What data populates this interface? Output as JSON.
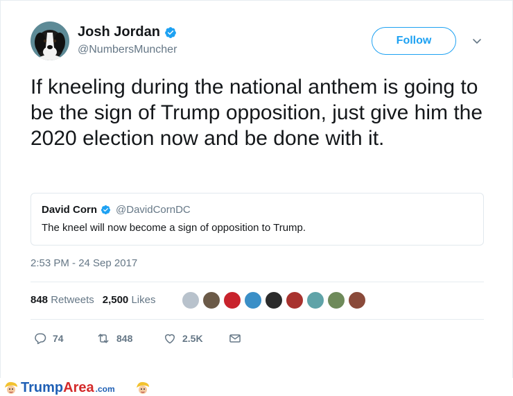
{
  "author": {
    "name": "Josh Jordan",
    "handle": "@NumbersMuncher",
    "verified": true,
    "avatar_icon": "dog-avatar-icon"
  },
  "follow_label": "Follow",
  "tweet_text": "If kneeling during the national anthem is going to be the sign of Trump opposition, just give him the 2020 election now and be done with it.",
  "quoted_tweet": {
    "name": "David Corn",
    "handle": "@DavidCornDC",
    "verified": true,
    "text": "The kneel will now become a sign of opposition to Trump."
  },
  "timestamp": "2:53 PM - 24 Sep 2017",
  "stats": {
    "retweets_count": "848",
    "retweets_label": "Retweets",
    "likes_count": "2,500",
    "likes_label": "Likes"
  },
  "likers": [
    {
      "color": "#b8c2cc"
    },
    {
      "color": "#6b5a48"
    },
    {
      "color": "#c8232c"
    },
    {
      "color": "#3a8fc7"
    },
    {
      "color": "#2b2b2b"
    },
    {
      "color": "#a8322e"
    },
    {
      "color": "#5fa3a8"
    },
    {
      "color": "#6e8a5a"
    },
    {
      "color": "#8a4a3a"
    }
  ],
  "actions": {
    "reply_count": "74",
    "retweet_count": "848",
    "like_count": "2.5K"
  },
  "footer": {
    "brand_trump": "Trump",
    "brand_area": "Area",
    "brand_domain": ".com"
  },
  "colors": {
    "accent": "#1da1f2",
    "text": "#14171a",
    "muted": "#657786"
  }
}
